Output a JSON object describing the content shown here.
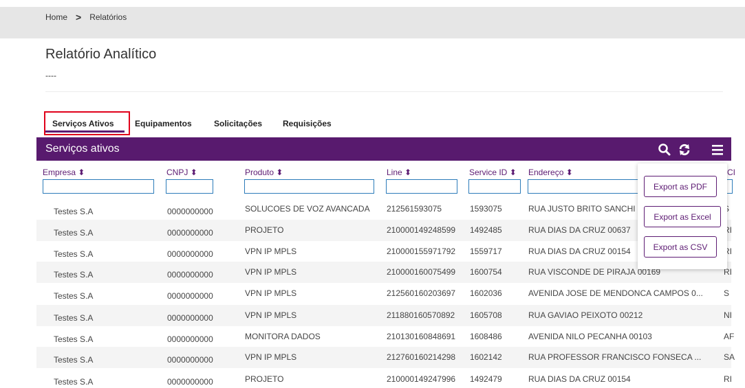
{
  "breadcrumb": {
    "home": "Home",
    "separator": ">",
    "current": "Relatórios"
  },
  "page": {
    "title": "Relatório Analítico",
    "subtitle": "----"
  },
  "tabs": [
    "Serviços Ativos",
    "Equipamentos",
    "Solicitações",
    "Requisições"
  ],
  "active_tab": "Serviços Ativos",
  "panel": {
    "title": "Serviços ativos"
  },
  "header_icons": [
    "search-icon",
    "refresh-icon",
    "menu-icon"
  ],
  "columns": [
    "Empresa",
    "CNPJ",
    "Produto",
    "Line",
    "Service ID",
    "Endereço",
    "CI"
  ],
  "rows": [
    [
      "Testes S.A",
      "0000000000",
      "SOLUCOES DE VOZ AVANCADA",
      "212561593075",
      "1593075",
      "RUA JUSTO BRITO SANCHI",
      "S"
    ],
    [
      "Testes S.A",
      "0000000000",
      "PROJETO",
      "210000149248599",
      "1492485",
      "RUA DIAS DA CRUZ 00637",
      "RI"
    ],
    [
      "Testes S.A",
      "0000000000",
      "VPN IP MPLS",
      "210000155971792",
      "1559717",
      "RUA DIAS DA CRUZ 00154",
      "RI"
    ],
    [
      "Testes S.A",
      "0000000000",
      "VPN IP MPLS",
      "210000160075499",
      "1600754",
      "RUA VISCONDE DE PIRAJA 00169",
      "RI"
    ],
    [
      "Testes S.A",
      "0000000000",
      "VPN IP MPLS",
      "212560160203697",
      "1602036",
      "AVENIDA JOSE DE MENDONCA CAMPOS 0...",
      "S"
    ],
    [
      "Testes S.A",
      "0000000000",
      "VPN IP MPLS",
      "211880160570892",
      "1605708",
      "RUA GAVIAO PEIXOTO 00212",
      "NI"
    ],
    [
      "Testes S.A",
      "0000000000",
      "MONITORA DADOS",
      "210130160848691",
      "1608486",
      "AVENIDA NILO PECANHA 00103",
      "AF"
    ],
    [
      "Testes S.A",
      "0000000000",
      "VPN IP MPLS",
      "212760160214298",
      "1602142",
      "RUA PROFESSOR FRANCISCO FONSECA ...",
      "SA"
    ],
    [
      "Testes S.A",
      "0000000000",
      "PROJETO",
      "210000149247996",
      "1492479",
      "RUA DIAS DA CRUZ 00154",
      "RI"
    ]
  ],
  "export_menu": [
    "Export as PDF",
    "Export as Excel",
    "Export as CSV"
  ],
  "colors": {
    "header_purple": "#581a6e",
    "active_outline": "#e0001a",
    "link_purple": "#5c1a72"
  }
}
